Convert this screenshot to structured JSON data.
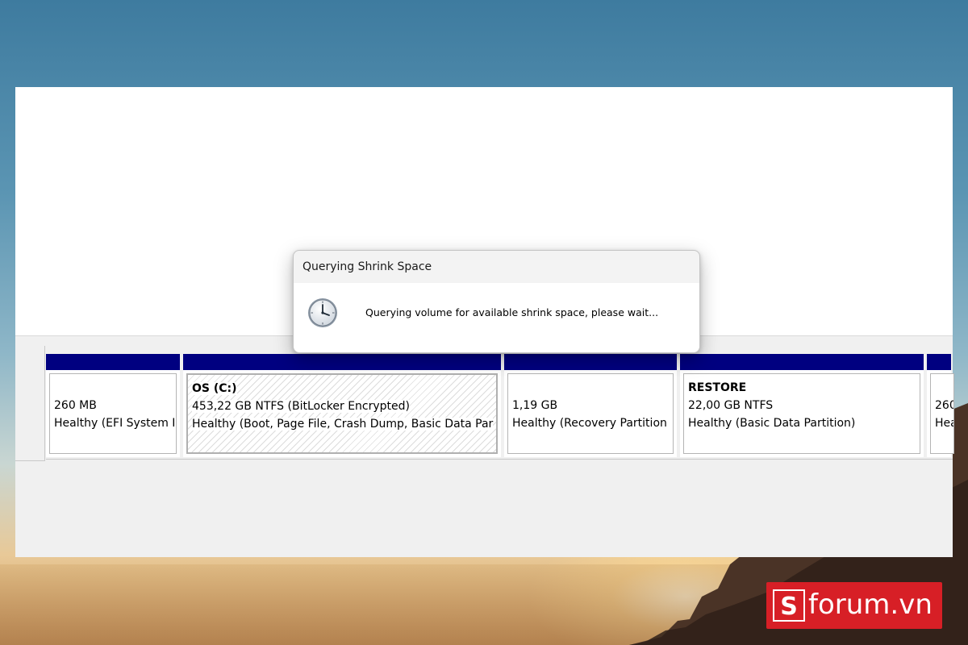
{
  "dialog": {
    "title": "Querying Shrink Space",
    "message": "Querying volume for available shrink space, please wait...",
    "icon": "clock-icon"
  },
  "partitions": [
    {
      "name": "",
      "line1": "260 MB",
      "line2": "Healthy (EFI System I"
    },
    {
      "name": "OS  (C:)",
      "line1": "453,22 GB NTFS (BitLocker Encrypted)",
      "line2": "Healthy (Boot, Page File, Crash Dump, Basic Data Par"
    },
    {
      "name": "",
      "line1": "1,19 GB",
      "line2": "Healthy (Recovery Partition"
    },
    {
      "name": "RESTORE",
      "line1": "22,00 GB NTFS",
      "line2": "Healthy (Basic Data Partition)"
    },
    {
      "name": "",
      "line1": "260",
      "line2": "Hea"
    }
  ],
  "colors": {
    "partition_bar": "#000080",
    "logo_bg": "#d71f26"
  },
  "watermark": {
    "text": "forum.vn",
    "mark": "S"
  }
}
